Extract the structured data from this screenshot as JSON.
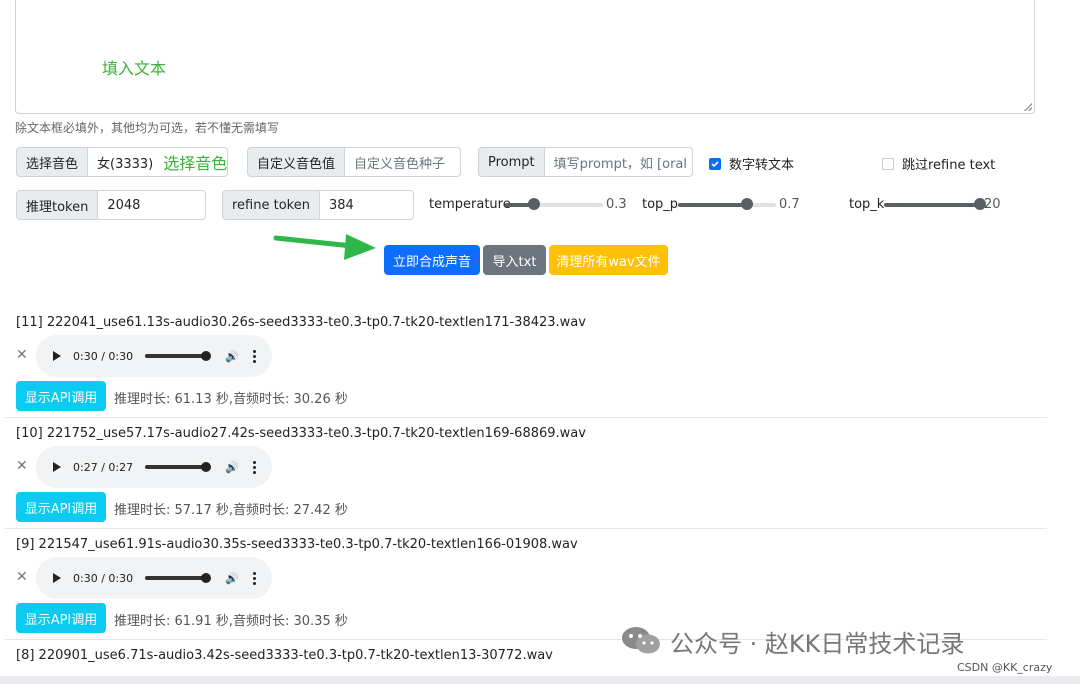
{
  "textarea": {
    "annotation": "填入文本"
  },
  "hint": "除文本框必填外，其他均为可选，若不懂无需填写",
  "voice": {
    "label": "选择音色",
    "value": "女(3333)",
    "annotation": "选择音色"
  },
  "custom_seed": {
    "label": "自定义音色值",
    "placeholder": "自定义音色种子"
  },
  "prompt": {
    "label": "Prompt",
    "placeholder": "填写prompt，如 [oral"
  },
  "num_to_text": {
    "label": "数字转文本",
    "checked": true
  },
  "skip_refine": {
    "label": "跳过refine text",
    "checked": false
  },
  "infer_token": {
    "label": "推理token",
    "value": "2048"
  },
  "refine_token": {
    "label": "refine token",
    "value": "384"
  },
  "temperature": {
    "label": "temperature",
    "value": "0.3",
    "fraction": 0.3
  },
  "top_p": {
    "label": "top_p",
    "value": "0.7",
    "fraction": 0.7
  },
  "top_k": {
    "label": "top_k",
    "value": "20",
    "fraction": 1.0
  },
  "buttons": {
    "synthesize": "立即合成声音",
    "import_txt": "导入txt",
    "clear_wav": "清理所有wav文件"
  },
  "results": [
    {
      "filename": "[11] 222041_use61.13s-audio30.26s-seed3333-te0.3-tp0.7-tk20-textlen171-38423.wav",
      "time": "0:30 / 0:30",
      "api_label": "显示API调用",
      "meta": "推理时长: 61.13 秒,音频时长: 30.26 秒"
    },
    {
      "filename": "[10] 221752_use57.17s-audio27.42s-seed3333-te0.3-tp0.7-tk20-textlen169-68869.wav",
      "time": "0:27 / 0:27",
      "api_label": "显示API调用",
      "meta": "推理时长: 57.17 秒,音频时长: 27.42 秒"
    },
    {
      "filename": "[9] 221547_use61.91s-audio30.35s-seed3333-te0.3-tp0.7-tk20-textlen166-01908.wav",
      "time": "0:30 / 0:30",
      "api_label": "显示API调用",
      "meta": "推理时长: 61.91 秒,音频时长: 30.35 秒"
    },
    {
      "filename": "[8] 220901_use6.71s-audio3.42s-seed3333-te0.3-tp0.7-tk20-textlen13-30772.wav"
    }
  ],
  "watermark": "公众号 · 赵KK日常技术记录",
  "credit": "CSDN @KK_crazy",
  "colors": {
    "primary": "#0d6efd",
    "secondary": "#6c757d",
    "warning": "#ffc107",
    "info": "#0dcaf0",
    "annotation": "#3bb33b"
  }
}
